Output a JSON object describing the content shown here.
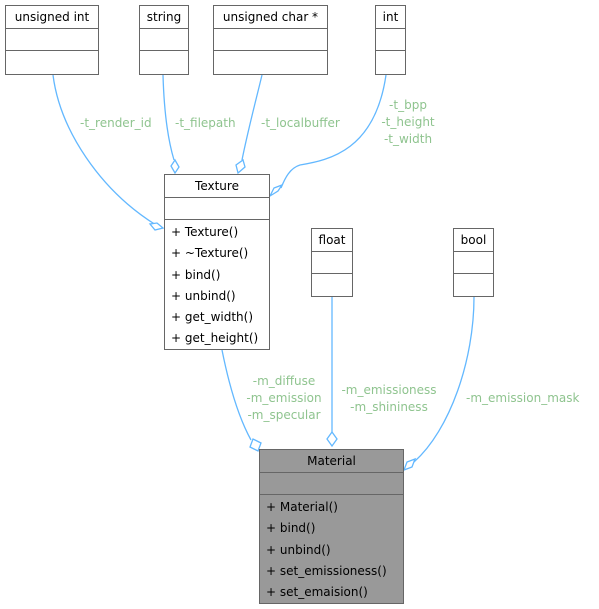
{
  "diagram": {
    "classes": {
      "unsigned_int": {
        "name": "unsigned int"
      },
      "string": {
        "name": "string"
      },
      "unsigned_char_ptr": {
        "name": "unsigned char *"
      },
      "int": {
        "name": "int"
      },
      "texture": {
        "name": "Texture",
        "methods": [
          "+ Texture()",
          "+ ~Texture()",
          "+ bind()",
          "+ unbind()",
          "+ get_width()",
          "+ get_height()"
        ]
      },
      "float": {
        "name": "float"
      },
      "bool": {
        "name": "bool"
      },
      "material": {
        "name": "Material",
        "methods": [
          "+ Material()",
          "+ bind()",
          "+ unbind()",
          "+ set_emissioness()",
          "+ set_emaision()"
        ]
      }
    },
    "edge_labels": {
      "render_id": "-t_render_id",
      "filepath": "-t_filepath",
      "localbuffer": "-t_localbuffer",
      "int_fields": [
        "-t_bpp",
        "-t_height",
        "-t_width"
      ],
      "texture_fields": [
        "-m_diffuse",
        "-m_emission",
        "-m_specular"
      ],
      "float_fields": [
        "-m_emissioness",
        "-m_shininess"
      ],
      "bool_fields": [
        "-m_emission_mask"
      ]
    },
    "colors": {
      "edge": "#63b8ff",
      "edge_label": "#8fc48f",
      "highlight_fill": "#999999",
      "border": "#666666"
    }
  }
}
